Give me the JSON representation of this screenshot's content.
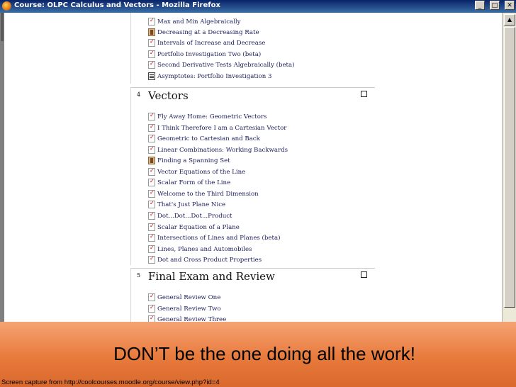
{
  "window": {
    "title": "Course: OLPC Calculus and Vectors - Mozilla Firefox",
    "controls": [
      "_",
      "□",
      "✕"
    ]
  },
  "sections": [
    {
      "number": "",
      "title": "",
      "activities": [
        {
          "icon": "quiz-icon",
          "label": "Max and Min Algebraically"
        },
        {
          "icon": "choice-icon",
          "label": "Decreasing at a Decreasing Rate"
        },
        {
          "icon": "quiz-icon",
          "label": "Intervals of Increase and Decrease"
        },
        {
          "icon": "quiz-icon",
          "label": "Portfolio Investigation Two (beta)"
        },
        {
          "icon": "quiz-icon",
          "label": "Second Derivative Tests Algebraically (beta)"
        },
        {
          "icon": "resource-icon",
          "label": "Asymptotes: Portfolio Investigation  3"
        }
      ]
    },
    {
      "number": "4",
      "title": "Vectors",
      "activities": [
        {
          "icon": "quiz-icon",
          "label": "Fly Away Home: Geometric Vectors"
        },
        {
          "icon": "quiz-icon",
          "label": "I Think Therefore I am a Cartesian Vector"
        },
        {
          "icon": "quiz-icon",
          "label": "Geometric to Cartesian and Back"
        },
        {
          "icon": "quiz-icon",
          "label": "Linear Combinations: Working Backwards"
        },
        {
          "icon": "choice-icon",
          "label": "Finding a Spanning Set"
        },
        {
          "icon": "quiz-icon",
          "label": "Vector Equations of the Line"
        },
        {
          "icon": "quiz-icon",
          "label": "Scalar Form of the Line"
        },
        {
          "icon": "quiz-icon",
          "label": "Welcome to the Third Dimension"
        },
        {
          "icon": "quiz-icon",
          "label": "That's Just Plane Nice"
        },
        {
          "icon": "quiz-icon",
          "label": "Dot...Dot...Dot...Product"
        },
        {
          "icon": "quiz-icon",
          "label": "Scalar Equation of a Plane"
        },
        {
          "icon": "quiz-icon",
          "label": "Intersections of Lines and Planes (beta)"
        },
        {
          "icon": "quiz-icon",
          "label": "Lines, Planes and Automobiles"
        },
        {
          "icon": "quiz-icon",
          "label": "Dot and Cross Product Properties"
        }
      ]
    },
    {
      "number": "5",
      "title": "Final Exam and Review",
      "activities": [
        {
          "icon": "quiz-icon",
          "label": "General Review One"
        },
        {
          "icon": "quiz-icon",
          "label": "General Review Two"
        },
        {
          "icon": "quiz-icon",
          "label": "General Review Three"
        }
      ]
    }
  ],
  "banner": {
    "headline": "DON’T be the one doing all the work!",
    "caption": "Screen capture from http://coolcourses.moodle.org/course/view.php?id=4"
  },
  "colors": {
    "banner_top": "#f5a373",
    "banner_bottom": "#d9692c",
    "link": "#1c1c5a",
    "titlebar": "#0a246a"
  }
}
